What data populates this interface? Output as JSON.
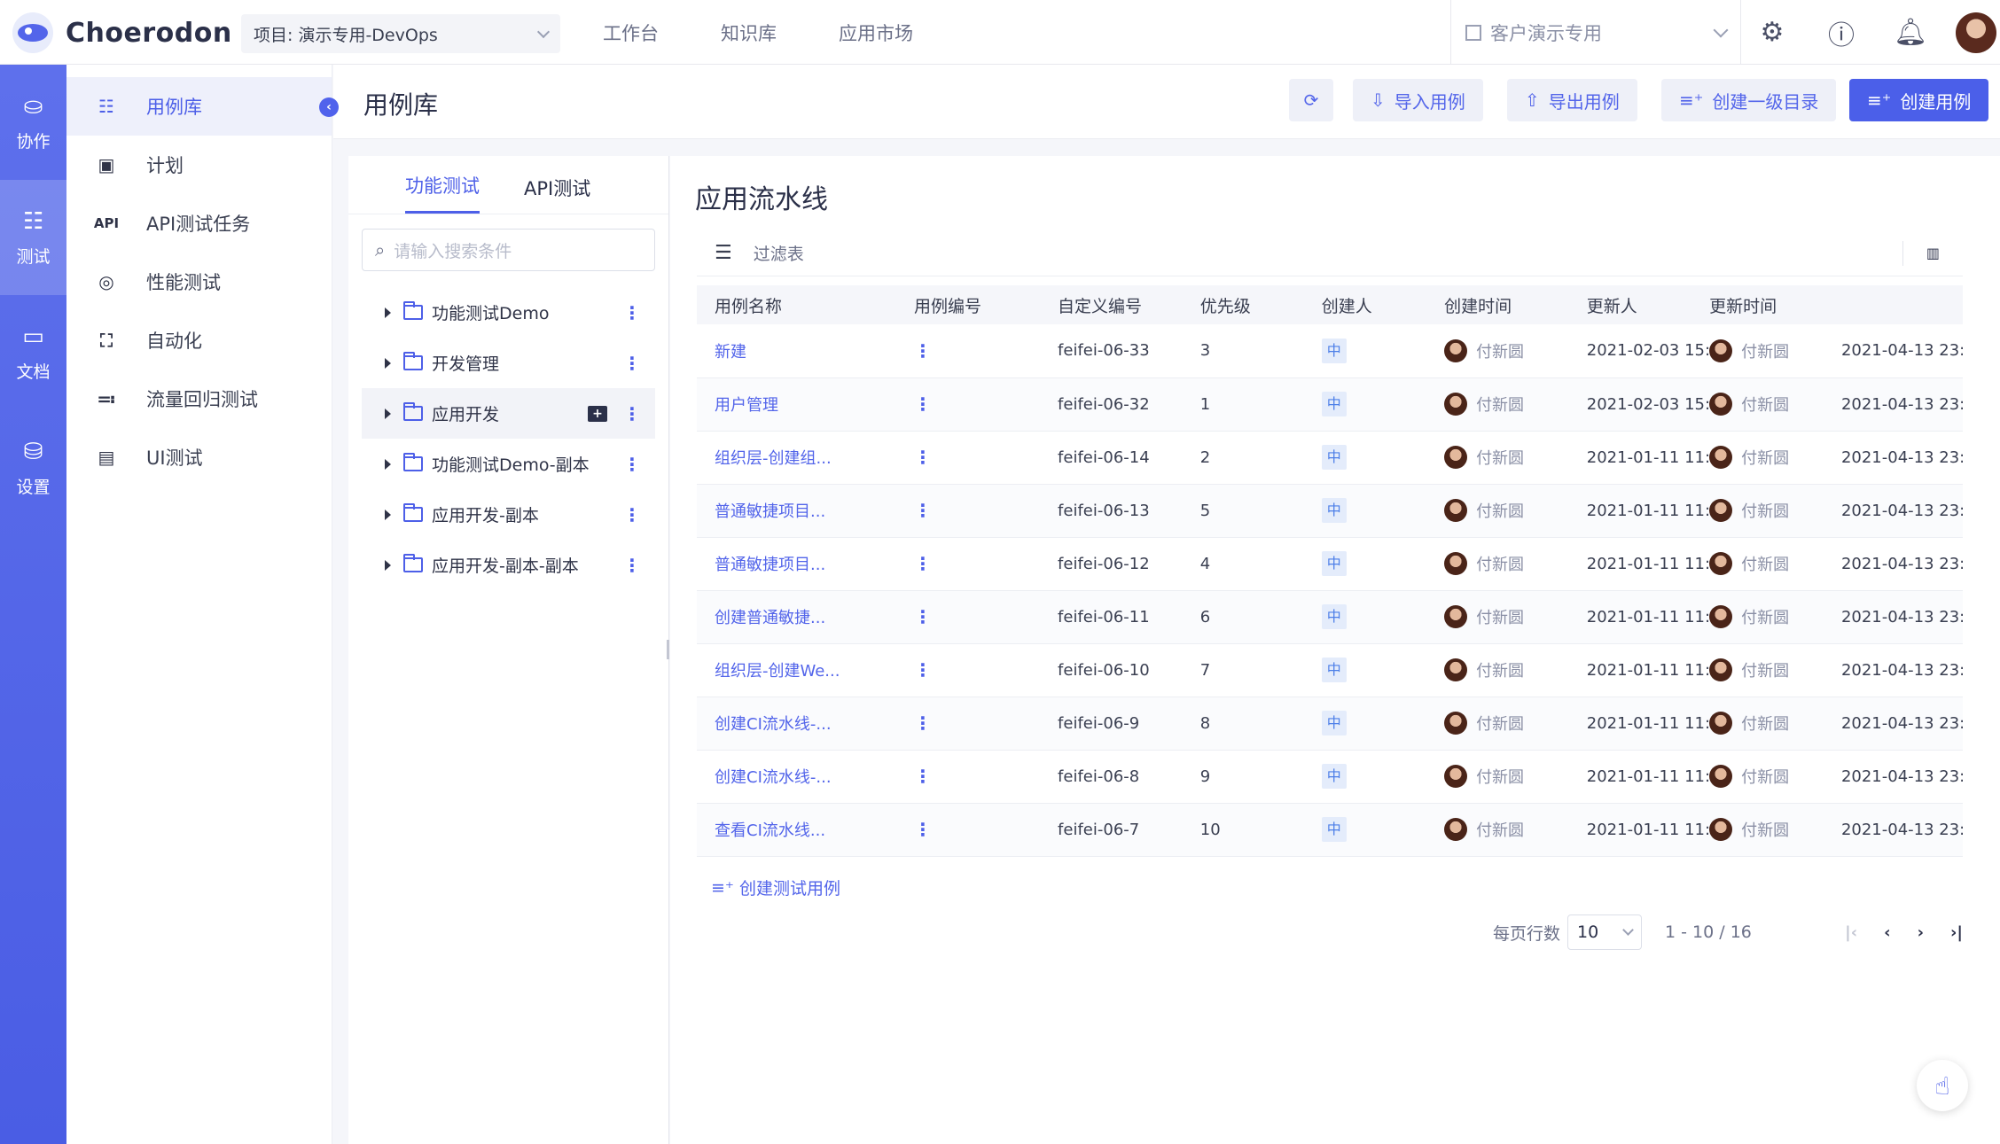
{
  "topbar": {
    "logo_text": "Choerodon",
    "project_select": "项目: 演示专用-DevOps",
    "nav": [
      "工作台",
      "知识库",
      "应用市场"
    ],
    "org_select": "客户演示专用"
  },
  "rail": {
    "items": [
      {
        "label": "协作",
        "icon": "cooperation-icon"
      },
      {
        "label": "测试",
        "icon": "test-icon"
      },
      {
        "label": "文档",
        "icon": "doc-icon"
      },
      {
        "label": "设置",
        "icon": "settings-icon"
      }
    ]
  },
  "sidebar": {
    "items": [
      {
        "label": "用例库",
        "icon": "☷"
      },
      {
        "label": "计划",
        "icon": "▣"
      },
      {
        "label": "API测试任务",
        "icon": "API"
      },
      {
        "label": "性能测试",
        "icon": "◎"
      },
      {
        "label": "自动化",
        "icon": "⛶"
      },
      {
        "label": "流量回归测试",
        "icon": "≕"
      },
      {
        "label": "UI测试",
        "icon": "▤"
      }
    ]
  },
  "header": {
    "title": "用例库",
    "buttons": {
      "refresh": "⟳",
      "import": "导入用例",
      "export": "导出用例",
      "create_dir": "创建一级目录",
      "create_case": "创建用例"
    }
  },
  "tree": {
    "tabs": [
      "功能测试",
      "API测试"
    ],
    "search_placeholder": "请输入搜索条件",
    "nodes": [
      "功能测试Demo",
      "开发管理",
      "应用开发",
      "功能测试Demo-副本",
      "应用开发-副本",
      "应用开发-副本-副本"
    ]
  },
  "main": {
    "title": "应用流水线",
    "filter_label": "过滤表",
    "columns": [
      "用例名称",
      "用例编号",
      "自定义编号",
      "优先级",
      "创建人",
      "创建时间",
      "更新人",
      "更新时间"
    ],
    "rows": [
      {
        "name": "新建",
        "code": "feifei-06-33",
        "custom": "3",
        "priority": "中",
        "creator": "付新圆",
        "created": "2021-02-03 15:...",
        "updater": "付新圆",
        "updated": "2021-04-13 23:..."
      },
      {
        "name": "用户管理",
        "code": "feifei-06-32",
        "custom": "1",
        "priority": "中",
        "creator": "付新圆",
        "created": "2021-02-03 15:...",
        "updater": "付新圆",
        "updated": "2021-04-13 23:..."
      },
      {
        "name": "组织层-创建组...",
        "code": "feifei-06-14",
        "custom": "2",
        "priority": "中",
        "creator": "付新圆",
        "created": "2021-01-11 11:...",
        "updater": "付新圆",
        "updated": "2021-04-13 23:..."
      },
      {
        "name": "普通敏捷项目...",
        "code": "feifei-06-13",
        "custom": "5",
        "priority": "中",
        "creator": "付新圆",
        "created": "2021-01-11 11:...",
        "updater": "付新圆",
        "updated": "2021-04-13 23:..."
      },
      {
        "name": "普通敏捷项目...",
        "code": "feifei-06-12",
        "custom": "4",
        "priority": "中",
        "creator": "付新圆",
        "created": "2021-01-11 11:...",
        "updater": "付新圆",
        "updated": "2021-04-13 23:..."
      },
      {
        "name": "创建普通敏捷...",
        "code": "feifei-06-11",
        "custom": "6",
        "priority": "中",
        "creator": "付新圆",
        "created": "2021-01-11 11:...",
        "updater": "付新圆",
        "updated": "2021-04-13 23:..."
      },
      {
        "name": "组织层-创建We...",
        "code": "feifei-06-10",
        "custom": "7",
        "priority": "中",
        "creator": "付新圆",
        "created": "2021-01-11 11:...",
        "updater": "付新圆",
        "updated": "2021-04-13 23:..."
      },
      {
        "name": "创建CI流水线-...",
        "code": "feifei-06-9",
        "custom": "8",
        "priority": "中",
        "creator": "付新圆",
        "created": "2021-01-11 11:...",
        "updater": "付新圆",
        "updated": "2021-04-13 23:..."
      },
      {
        "name": "创建CI流水线-...",
        "code": "feifei-06-8",
        "custom": "9",
        "priority": "中",
        "creator": "付新圆",
        "created": "2021-01-11 11:...",
        "updater": "付新圆",
        "updated": "2021-04-13 23:..."
      },
      {
        "name": "查看CI流水线...",
        "code": "feifei-06-7",
        "custom": "10",
        "priority": "中",
        "creator": "付新圆",
        "created": "2021-01-11 11:...",
        "updater": "付新圆",
        "updated": "2021-04-13 23:..."
      }
    ],
    "create_case_link": "创建测试用例",
    "pager": {
      "rows_label": "每页行数",
      "page_size": "10",
      "range": "1 - 10 / 16"
    }
  },
  "colors": {
    "accent": "#4d5fe8",
    "rail": "#5365ea"
  }
}
